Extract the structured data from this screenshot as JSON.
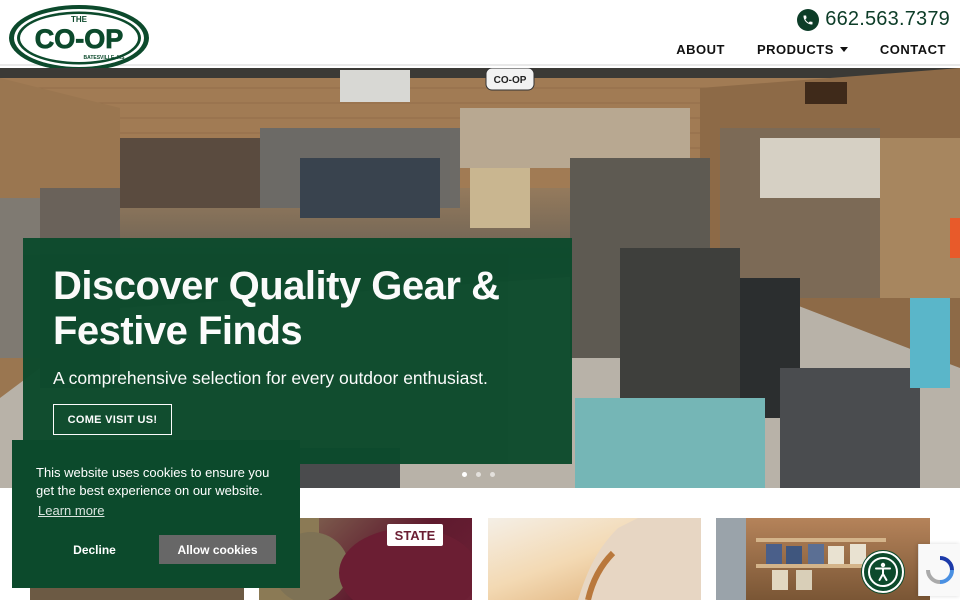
{
  "header": {
    "logo": {
      "top_text": "THE",
      "main_text": "CO-OP",
      "sub_text": "BATESVILLE, MS"
    },
    "phone": "662.563.7379",
    "nav": [
      {
        "label": "ABOUT"
      },
      {
        "label": "PRODUCTS"
      },
      {
        "label": "CONTACT"
      }
    ]
  },
  "hero": {
    "title": "Discover Quality Gear & Festive Finds",
    "subtitle": "A comprehensive selection for every outdoor enthusiast.",
    "cta": "COME VISIT US!",
    "slides": {
      "count": 3,
      "active": 0
    },
    "store_sign": "CO-OP"
  },
  "cookie": {
    "message": "This website uses cookies to ensure you get the best experience on our website.",
    "learn_more": "Learn more",
    "decline": "Decline",
    "allow": "Allow cookies"
  },
  "cards": [
    {
      "icon": "photo-card-outdoor"
    },
    {
      "icon": "photo-card-caps",
      "label": "STATE"
    },
    {
      "icon": "photo-card-horse"
    },
    {
      "icon": "photo-card-shelves"
    }
  ],
  "colors": {
    "brand_green": "#0c4a2c",
    "cookie_allow": "#676767"
  },
  "icons": {
    "phone": "phone-icon",
    "accessibility": "accessibility-icon",
    "recaptcha": "recaptcha-icon"
  }
}
